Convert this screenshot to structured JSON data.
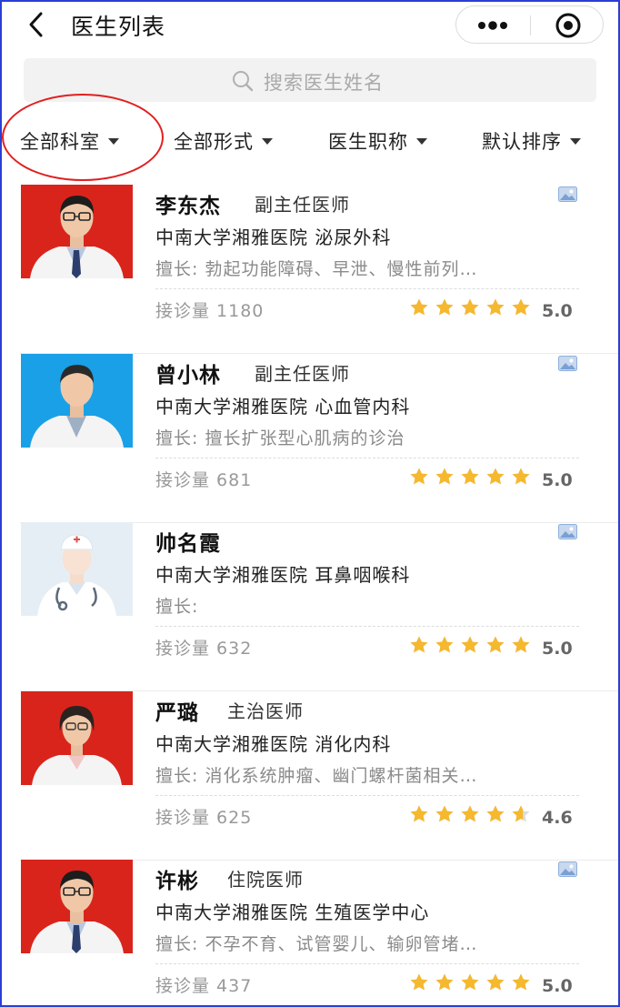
{
  "header": {
    "title": "医生列表"
  },
  "search": {
    "placeholder": "搜索医生姓名"
  },
  "filters": [
    {
      "label": "全部科室"
    },
    {
      "label": "全部形式"
    },
    {
      "label": "医生职称"
    },
    {
      "label": "默认排序"
    }
  ],
  "colors": {
    "star": "#f5b82e",
    "star_empty": "#dcdcdc",
    "annotation": "#e02020",
    "frame": "#2a3fd6"
  },
  "doctors": [
    {
      "name": "李东杰",
      "title": "副主任医师",
      "hospital": "中南大学湘雅医院 泌尿外科",
      "specialty": "擅长: 勃起功能障碍、早泄、慢性前列…",
      "consult_label": "接诊量 1180",
      "rating": "5.0",
      "rating_value": 5.0,
      "photo": "man-red-bg"
    },
    {
      "name": "曾小林",
      "title": "副主任医师",
      "hospital": "中南大学湘雅医院 心血管内科",
      "specialty": "擅长: 擅长扩张型心肌病的诊治",
      "consult_label": "接诊量 681",
      "rating": "5.0",
      "rating_value": 5.0,
      "photo": "man-blue-bg"
    },
    {
      "name": "帅名霞",
      "title": "",
      "hospital": "中南大学湘雅医院 耳鼻咽喉科",
      "specialty": "擅长:",
      "consult_label": "接诊量 632",
      "rating": "5.0",
      "rating_value": 5.0,
      "photo": "placeholder-doctor"
    },
    {
      "name": "严璐",
      "title": "主治医师",
      "hospital": "中南大学湘雅医院 消化内科",
      "specialty": "擅长: 消化系统肿瘤、幽门螺杆菌相关…",
      "consult_label": "接诊量 625",
      "rating": "4.6",
      "rating_value": 4.6,
      "photo": "woman-red-bg"
    },
    {
      "name": "许彬",
      "title": "住院医师",
      "hospital": "中南大学湘雅医院 生殖医学中心",
      "specialty": "擅长: 不孕不育、试管婴儿、输卵管堵…",
      "consult_label": "接诊量 437",
      "rating": "5.0",
      "rating_value": 5.0,
      "photo": "man-red-bg"
    }
  ]
}
